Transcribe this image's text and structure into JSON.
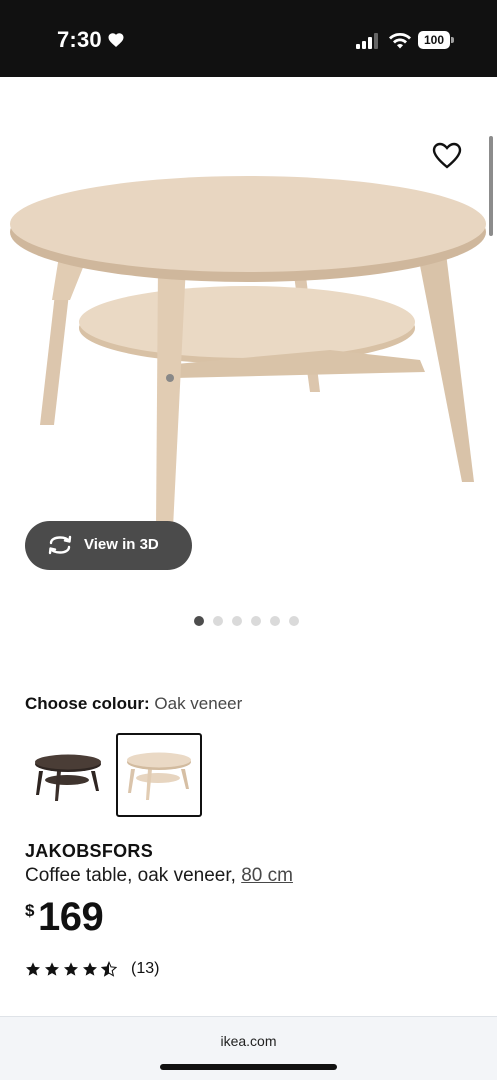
{
  "status_bar": {
    "time": "7:30",
    "battery": "100",
    "icons": [
      "heart-icon",
      "signal-icon",
      "wifi-icon",
      "battery-icon"
    ]
  },
  "gallery": {
    "view_3d_label": "View in 3D",
    "dot_count": 6,
    "active_dot": 0
  },
  "colour": {
    "label": "Choose colour:",
    "selected": "Oak veneer",
    "swatches": [
      "dark-brown-table",
      "oak-veneer-table"
    ],
    "selected_index": 1
  },
  "product": {
    "name": "JAKOBSFORS",
    "description": "Coffee table, oak veneer,",
    "size": "80 cm",
    "currency": "$",
    "price": "169",
    "rating": 4.5,
    "reviews": "(13)"
  },
  "browser": {
    "url": "ikea.com"
  },
  "colors": {
    "status_bar_bg": "#111111",
    "view_3d_bg": "#4b4b4b",
    "oak": "#e6d3bd",
    "dark_brown": "#3d322c"
  }
}
